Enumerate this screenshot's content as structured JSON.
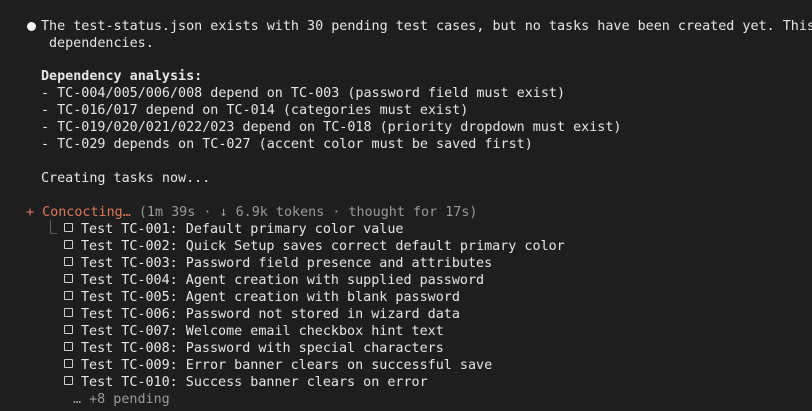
{
  "message": {
    "line1": "The test-status.json exists with 30 pending test cases, but no tasks have been created yet. This",
    "line2": "dependencies."
  },
  "dependency": {
    "heading": "Dependency analysis:",
    "items": [
      "- TC-004/005/006/008 depend on TC-003 (password field must exist)",
      "- TC-016/017 depend on TC-014 (categories must exist)",
      "- TC-019/020/021/022/023 depend on TC-018 (priority dropdown must exist)",
      "- TC-029 depends on TC-027 (accent color must be saved first)"
    ]
  },
  "creating": "Creating tasks now...",
  "status": {
    "symbol": "+",
    "verb": "Concocting…",
    "meta": " (1m 39s · ↓ 6.9k tokens · thought for 17s)"
  },
  "tree_glyph": "⎿",
  "tasks": [
    "Test TC-001: Default primary color value",
    "Test TC-002: Quick Setup saves correct default primary color",
    "Test TC-003: Password field presence and attributes",
    "Test TC-004: Agent creation with supplied password",
    "Test TC-005: Agent creation with blank password",
    "Test TC-006: Password not stored in wizard data",
    "Test TC-007: Welcome email checkbox hint text",
    "Test TC-008: Password with special characters",
    "Test TC-009: Error banner clears on successful save",
    "Test TC-010: Success banner clears on error"
  ],
  "more_pending": "… +8 pending"
}
